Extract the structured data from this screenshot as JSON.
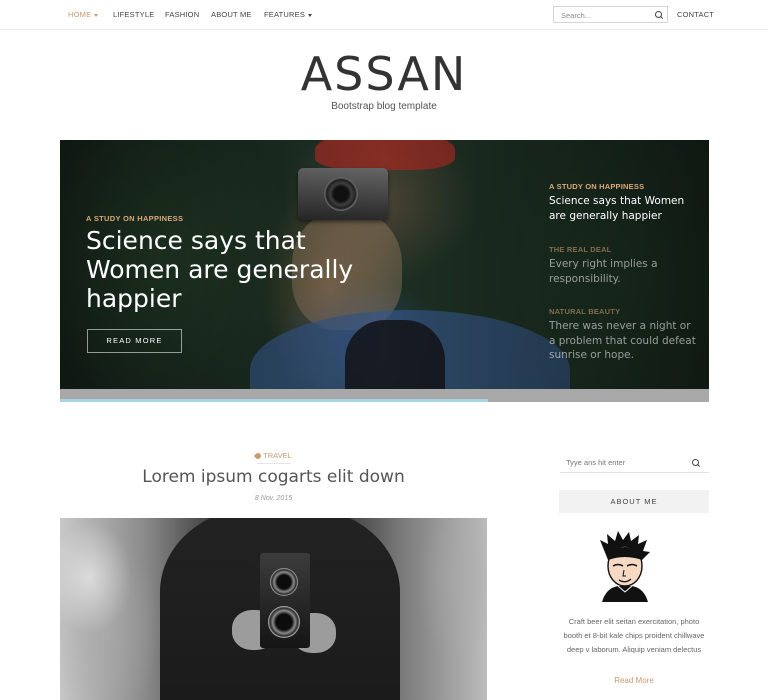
{
  "nav": {
    "items": [
      {
        "label": "HOME",
        "has_caret": true
      },
      {
        "label": "LIFESTYLE"
      },
      {
        "label": "FASHION"
      },
      {
        "label": "ABOUT ME"
      },
      {
        "label": "FEATURES",
        "has_caret": true
      }
    ],
    "search_placeholder": "Search...",
    "contact": "CONTACT"
  },
  "brand": {
    "title": "ASSAN",
    "subtitle": "Bootstrap blog template"
  },
  "hero": {
    "category": "A STUDY ON HAPPINESS",
    "title": "Science says that Women are generally happier",
    "button": "READ MORE",
    "side_posts": [
      {
        "category": "A STUDY ON HAPPINESS",
        "title": "Science says that Women are generally happier"
      },
      {
        "category": "THE REAL DEAL",
        "title": "Every right implies a responsibility."
      },
      {
        "category": "NATURAL BEAUTY",
        "title": "There was never a night or a problem that could defeat sunrise or hope."
      }
    ],
    "progress": 0.66
  },
  "post": {
    "category": "TRAVEL",
    "title": "Lorem ipsum cogarts elit down",
    "date": "8 Nov. 2015"
  },
  "sidebar": {
    "search_placeholder": "Tyye ans hit enter",
    "about_heading": "ABOUT ME",
    "about_text": "Craft beer elit seitan exercitation, photo booth et 8-bit kale chips proident chillwave deep v laborum. Aliquip veniam delectus",
    "read_more": "Read More"
  },
  "colors": {
    "accent": "#c99a6e",
    "hero_category": "#d9a878",
    "progress_fill": "#a9d4e6"
  }
}
